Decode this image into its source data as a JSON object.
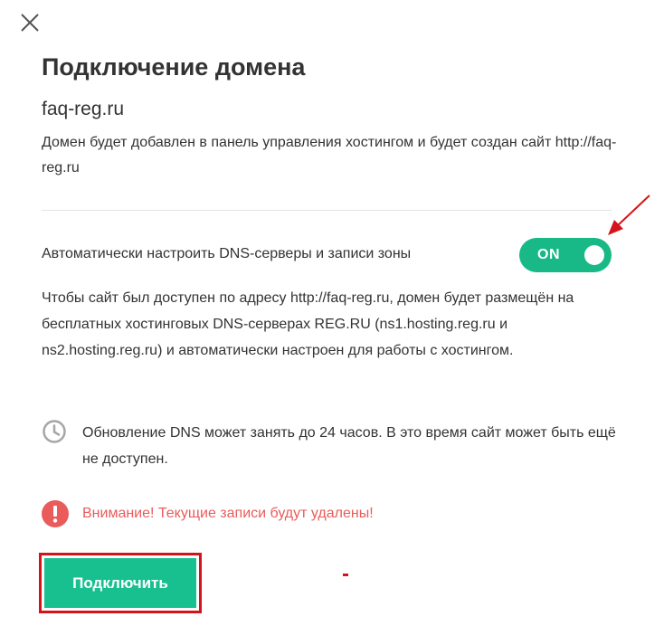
{
  "modal": {
    "title": "Подключение домена",
    "domain": "faq-reg.ru",
    "description": "Домен будет добавлен в панель управления хостингом и будет создан сайт http://faq-reg.ru",
    "close_icon": "close-icon"
  },
  "dns": {
    "toggle_label": "Автоматически настроить DNS-серверы и записи зоны",
    "toggle_state": "ON",
    "toggle_on": true,
    "info": "Чтобы сайт был доступен по адресу http://faq-reg.ru, домен будет размещён на бесплатных хостинговых DNS-серверах REG.RU (ns1.hosting.reg.ru и ns2.hosting.reg.ru) и автоматически настроен для работы с хостингом."
  },
  "notice": {
    "icon": "clock-icon",
    "text": "Обновление DNS может занять до 24 часов. В это время сайт может быть ещё не доступен."
  },
  "warning": {
    "icon": "exclamation-icon",
    "text": "Внимание! Текущие записи будут удалены!"
  },
  "actions": {
    "connect_label": "Подключить"
  },
  "colors": {
    "accent": "#18c08f",
    "warning": "#ea5b5b",
    "annotation": "#d4141a",
    "text": "#333333",
    "icon_gray": "#a6a6a6"
  }
}
